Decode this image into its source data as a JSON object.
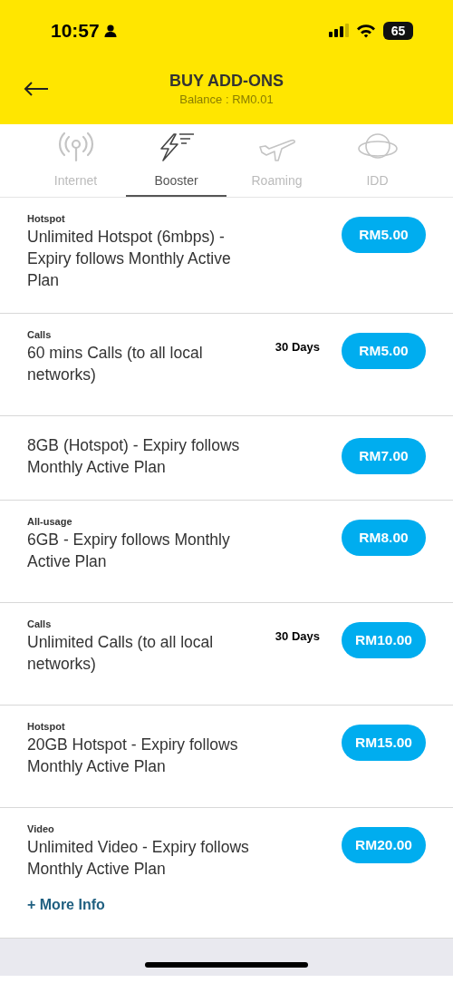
{
  "status_bar": {
    "time": "10:57",
    "battery": "65"
  },
  "header": {
    "title": "BUY ADD-ONS",
    "subtitle": "Balance : RM0.01"
  },
  "tabs": [
    {
      "label": "Internet",
      "kind": "antenna",
      "selected": false
    },
    {
      "label": "Booster",
      "kind": "bolt",
      "selected": true
    },
    {
      "label": "Roaming",
      "kind": "plane",
      "selected": false
    },
    {
      "label": "IDD",
      "kind": "globe",
      "selected": false
    }
  ],
  "addons": [
    {
      "category": "Hotspot",
      "title": "Unlimited Hotspot (6mbps) - Expiry follows Monthly Active Plan",
      "price": "RM5.00"
    },
    {
      "category": "Calls",
      "validity": "30 Days",
      "title": "60 mins Calls (to all local networks)",
      "price": "RM5.00"
    },
    {
      "title": "8GB (Hotspot) - Expiry follows Monthly Active Plan",
      "price": "RM7.00"
    },
    {
      "category": "All-usage",
      "title": "6GB - Expiry follows Monthly Active Plan",
      "price": "RM8.00"
    },
    {
      "category": "Calls",
      "validity": "30 Days",
      "title": "Unlimited Calls (to all local networks)",
      "price": "RM10.00"
    },
    {
      "category": "Hotspot",
      "title": "20GB Hotspot - Expiry follows Monthly Active Plan",
      "price": "RM15.00"
    },
    {
      "category": "Video",
      "title": "Unlimited Video - Expiry follows Monthly Active Plan",
      "price": "RM20.00",
      "more_link": "+ More Info"
    }
  ]
}
